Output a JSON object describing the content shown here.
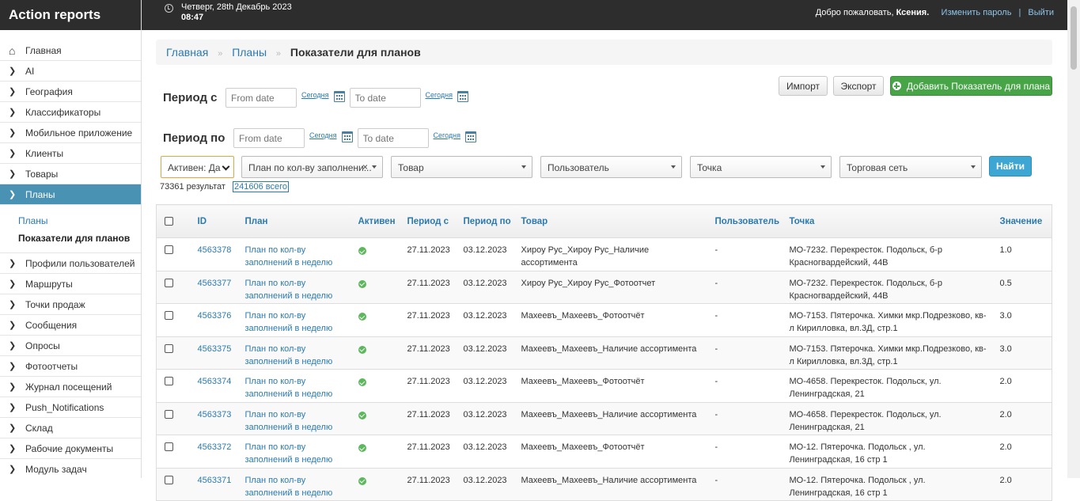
{
  "app_title": "Action reports",
  "header": {
    "date": "Четверг, 28th Декабрь 2023",
    "time": "08:47",
    "welcome": "Добро пожаловать,",
    "user_name": "Ксения.",
    "change_password": "Изменить пароль",
    "separator": "|",
    "logout": "Выйти"
  },
  "sidebar": {
    "items_top": [
      {
        "label": "Главная",
        "icon": "home-icon"
      },
      {
        "label": "AI",
        "icon": "chevron-right-icon"
      },
      {
        "label": "География",
        "icon": "chevron-right-icon"
      },
      {
        "label": "Классификаторы",
        "icon": "chevron-right-icon"
      },
      {
        "label": "Мобильное приложение",
        "icon": "chevron-right-icon"
      },
      {
        "label": "Клиенты",
        "icon": "chevron-right-icon"
      },
      {
        "label": "Товары",
        "icon": "chevron-right-icon"
      }
    ],
    "active_item": {
      "label": "Планы",
      "icon": "chevron-right-icon"
    },
    "submenu": {
      "plans": "Планы",
      "current": "Показатели для планов"
    },
    "items_bottom": [
      {
        "label": "Профили пользователей"
      },
      {
        "label": "Маршруты"
      },
      {
        "label": "Точки продаж"
      },
      {
        "label": "Сообщения"
      },
      {
        "label": "Опросы"
      },
      {
        "label": "Фотоотчеты"
      },
      {
        "label": "Журнал посещений"
      },
      {
        "label": "Push_Notifications"
      },
      {
        "label": "Склад"
      },
      {
        "label": "Рабочие документы"
      },
      {
        "label": "Модуль задач"
      }
    ]
  },
  "breadcrumb": {
    "home": "Главная",
    "sep": "»",
    "plans": "Планы",
    "current": "Показатели для планов"
  },
  "period_from": {
    "label": "Период с",
    "from_placeholder": "From date",
    "today1": "Сегодня",
    "to_placeholder": "To date",
    "today2": "Сегодня"
  },
  "period_to": {
    "label": "Период по",
    "from_placeholder": "From date",
    "today1": "Сегодня",
    "to_placeholder": "To date",
    "today2": "Сегодня"
  },
  "actions": {
    "import": "Импорт",
    "export": "Экспорт",
    "add": "Добавить Показатель для плана"
  },
  "filters": {
    "active": "Активен: Да",
    "plan": "План по кол-ву заполнени...",
    "clear": "×",
    "product": "Товар",
    "user": "Пользователь",
    "point": "Точка",
    "network": "Торговая сеть",
    "find": "Найти"
  },
  "results": {
    "count": "73361 результат",
    "total": "241606 всего"
  },
  "table": {
    "columns": [
      "ID",
      "План",
      "Активен",
      "Период с",
      "Период по",
      "Товар",
      "Пользователь",
      "Точка",
      "Значение"
    ],
    "rows": [
      {
        "id": "4563378",
        "plan": "План по кол-ву заполнений в неделю",
        "from": "27.11.2023",
        "to": "03.12.2023",
        "product": "Хироу Рус_Хироу Рус_Наличие ассортимента",
        "user": "-",
        "point": "МО-7232. Перекресток. Подольск, б-р Красногвардейский, 44В",
        "value": "1.0"
      },
      {
        "id": "4563377",
        "plan": "План по кол-ву заполнений в неделю",
        "from": "27.11.2023",
        "to": "03.12.2023",
        "product": "Хироу Рус_Хироу Рус_Фотоотчет",
        "user": "-",
        "point": "МО-7232. Перекресток. Подольск, б-р Красногвардейский, 44В",
        "value": "0.5"
      },
      {
        "id": "4563376",
        "plan": "План по кол-ву заполнений в неделю",
        "from": "27.11.2023",
        "to": "03.12.2023",
        "product": "Махеевъ_Махеевъ_Фотоотчёт",
        "user": "-",
        "point": "МО-7153. Пятерочка. Химки мкр.Подрезково, кв-л Кирилловка, вл.3Д, стр.1",
        "value": "3.0"
      },
      {
        "id": "4563375",
        "plan": "План по кол-ву заполнений в неделю",
        "from": "27.11.2023",
        "to": "03.12.2023",
        "product": "Махеевъ_Махеевъ_Наличие ассортимента",
        "user": "-",
        "point": "МО-7153. Пятерочка. Химки мкр.Подрезково, кв-л Кирилловка, вл.3Д, стр.1",
        "value": "3.0"
      },
      {
        "id": "4563374",
        "plan": "План по кол-ву заполнений в неделю",
        "from": "27.11.2023",
        "to": "03.12.2023",
        "product": "Махеевъ_Махеевъ_Фотоотчёт",
        "user": "-",
        "point": "МО-4658. Перекресток. Подольск, ул. Ленинградская, 21",
        "value": "2.0"
      },
      {
        "id": "4563373",
        "plan": "План по кол-ву заполнений в неделю",
        "from": "27.11.2023",
        "to": "03.12.2023",
        "product": "Махеевъ_Махеевъ_Наличие ассортимента",
        "user": "-",
        "point": "МО-4658. Перекресток. Подольск, ул. Ленинградская, 21",
        "value": "2.0"
      },
      {
        "id": "4563372",
        "plan": "План по кол-ву заполнений в неделю",
        "from": "27.11.2023",
        "to": "03.12.2023",
        "product": "Махеевъ_Махеевъ_Фотоотчёт",
        "user": "-",
        "point": "МО-12. Пятерочка. Подольск , ул. Ленинградская, 16 стр 1",
        "value": "2.0"
      },
      {
        "id": "4563371",
        "plan": "План по кол-ву заполнений в неделю",
        "from": "27.11.2023",
        "to": "03.12.2023",
        "product": "Махеевъ_Махеевъ_Наличие ассортимента",
        "user": "-",
        "point": "МО-12. Пятерочка. Подольск , ул. Ленинградская, 16 стр 1",
        "value": "2.0"
      }
    ]
  }
}
